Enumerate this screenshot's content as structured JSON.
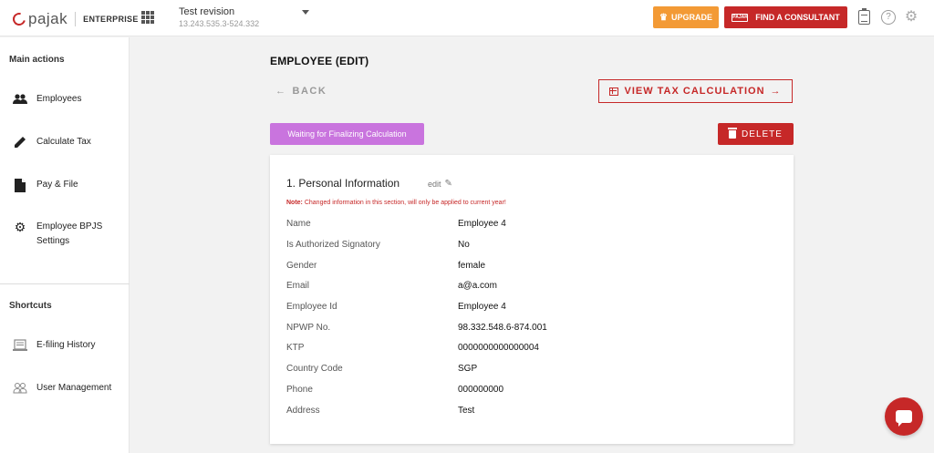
{
  "brand": {
    "logo_text": "pajak",
    "edition": "ENTERPRISE"
  },
  "company": {
    "name": "Test revision",
    "npwp": "13.243.535.3-524.332"
  },
  "header": {
    "upgrade_label": "UPGRADE",
    "consultant_label": "FIND A CONSULTANT",
    "consultant_badge": "PAJAK",
    "help_glyph": "?",
    "gear_glyph": "⚙"
  },
  "sidebar": {
    "main_heading": "Main actions",
    "main_items": [
      {
        "label": "Employees",
        "icon": "people-icon"
      },
      {
        "label": "Calculate Tax",
        "icon": "pencil-icon"
      },
      {
        "label": "Pay & File",
        "icon": "document-icon"
      },
      {
        "label": "Employee BPJS Settings",
        "icon": "gear-icon"
      }
    ],
    "shortcuts_heading": "Shortcuts",
    "shortcut_items": [
      {
        "label": "E-filing History",
        "icon": "history-icon"
      },
      {
        "label": "User Management",
        "icon": "users-icon"
      }
    ]
  },
  "page": {
    "title": "EMPLOYEE (EDIT)",
    "back_label": "BACK",
    "view_tax_label": "VIEW TAX CALCULATION",
    "status": "Waiting for Finalizing Calculation",
    "delete_label": "DELETE"
  },
  "personal_info": {
    "title": "1. Personal Information",
    "edit_label": "edit",
    "note_prefix": "Note:",
    "note_text": " Changed information in this section, will only be applied to current year!",
    "rows": [
      {
        "label": "Name",
        "value": "Employee 4"
      },
      {
        "label": "Is Authorized Signatory",
        "value": "No"
      },
      {
        "label": "Gender",
        "value": "female"
      },
      {
        "label": "Email",
        "value": "a@a.com"
      },
      {
        "label": "Employee Id",
        "value": "Employee 4"
      },
      {
        "label": "NPWP No.",
        "value": "98.332.548.6-874.001"
      },
      {
        "label": "KTP",
        "value": "0000000000000004"
      },
      {
        "label": "Country Code",
        "value": "SGP"
      },
      {
        "label": "Phone",
        "value": "000000000"
      },
      {
        "label": "Address",
        "value": "Test"
      }
    ]
  },
  "colors": {
    "brand_red": "#c62828",
    "upgrade_orange": "#f39a35",
    "status_purple": "#c974de"
  }
}
